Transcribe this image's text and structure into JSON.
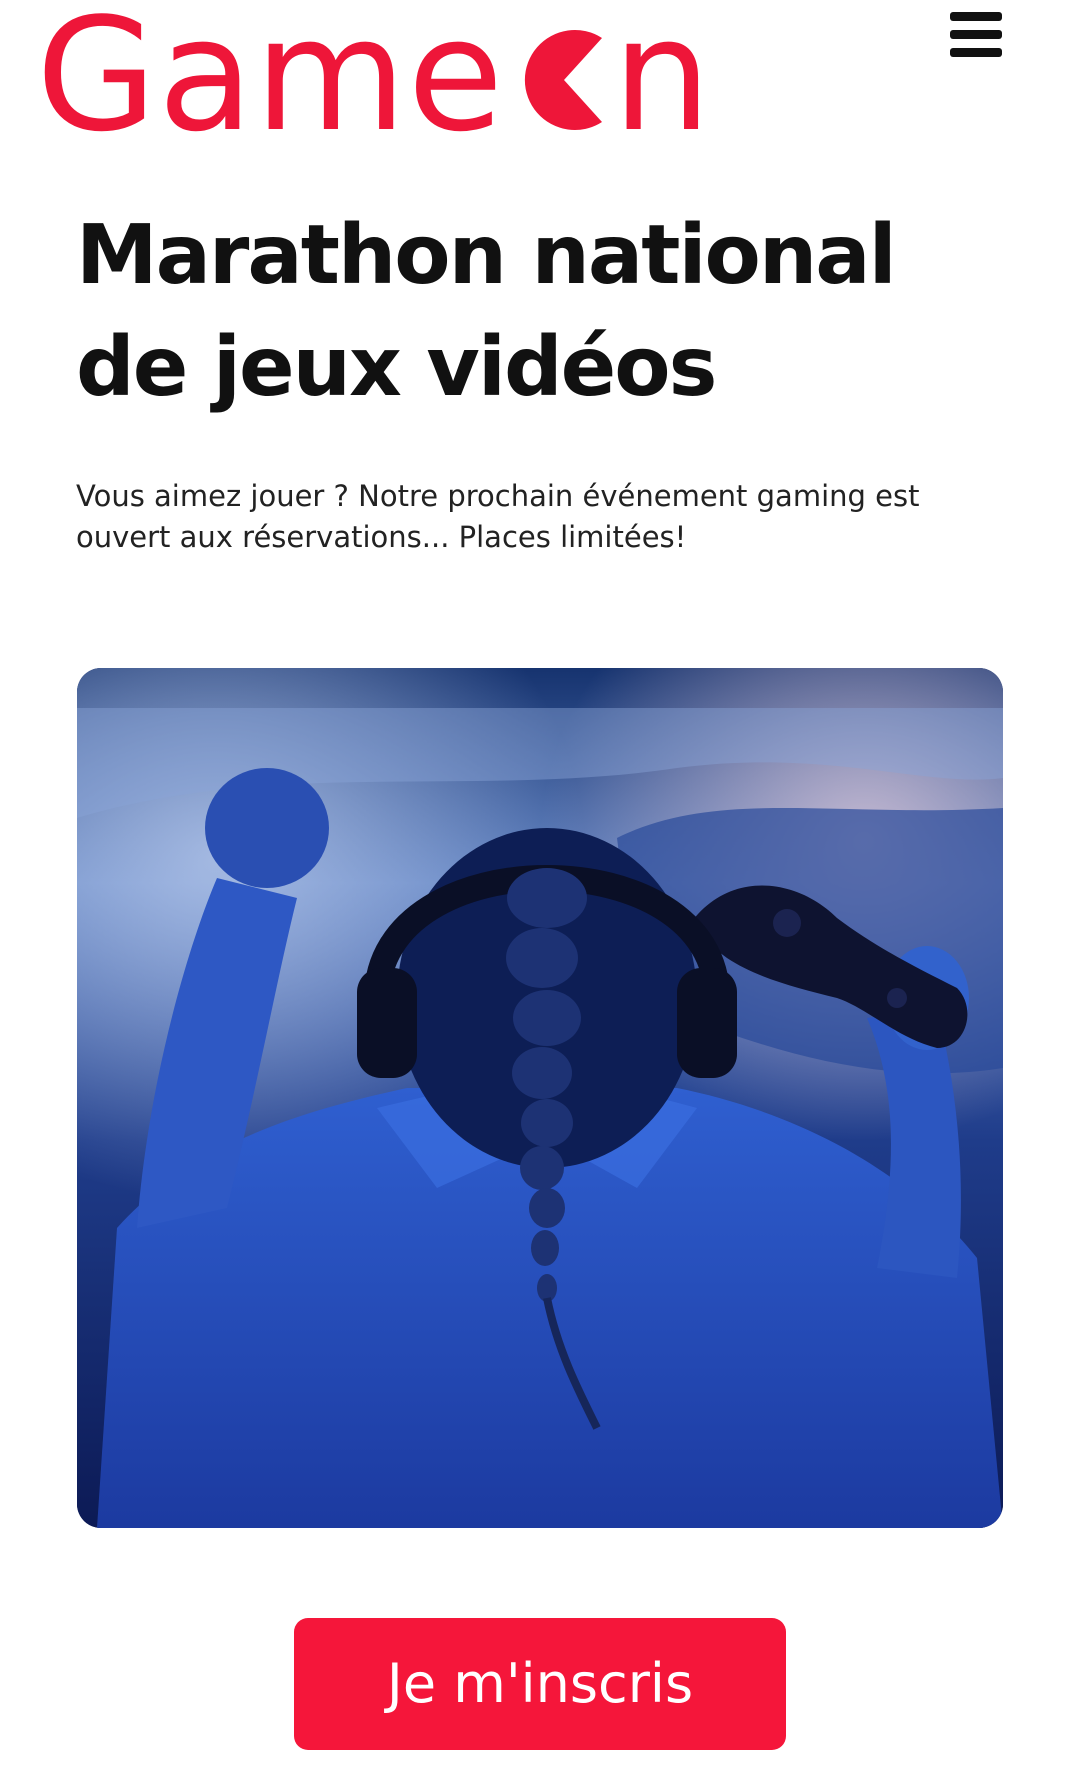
{
  "header": {
    "logo": {
      "text": "GameOn",
      "prefix": "Game",
      "suffix": "n",
      "color": "#ee1639"
    },
    "menu_icon": "hamburger-menu-icon"
  },
  "main": {
    "title_lines": [
      "Marathon national",
      "de jeux vidéos"
    ],
    "intro_lines": [
      "Vous aimez jouer ? Notre prochain événement gaming est",
      "ouvert aux réservations... Places limitées!"
    ],
    "hero_image": "gamer-with-headphones-and-controller-photo",
    "cta_label": "Je m'inscris",
    "cta_color": "#f5163a"
  }
}
